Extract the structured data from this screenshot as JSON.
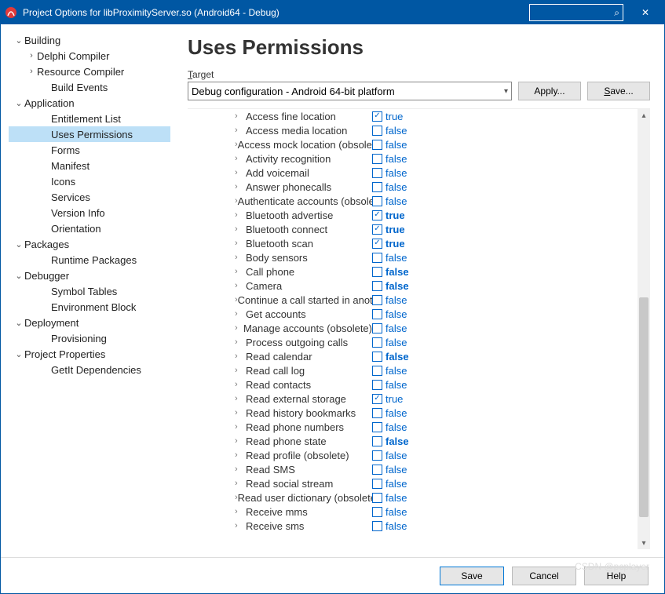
{
  "window": {
    "title": "Project Options for libProximityServer.so  (Android64 - Debug)",
    "search_placeholder": "",
    "close_glyph": "✕"
  },
  "sidebar": [
    {
      "label": "Building",
      "kind": "group",
      "open": true,
      "indent": 0
    },
    {
      "label": "Delphi Compiler",
      "kind": "sub",
      "indent": 1
    },
    {
      "label": "Resource Compiler",
      "kind": "sub",
      "indent": 1
    },
    {
      "label": "Build Events",
      "kind": "leaf",
      "indent": 2
    },
    {
      "label": "Application",
      "kind": "group",
      "open": true,
      "indent": 0
    },
    {
      "label": "Entitlement List",
      "kind": "leaf",
      "indent": 2
    },
    {
      "label": "Uses Permissions",
      "kind": "leaf",
      "indent": 2,
      "selected": true
    },
    {
      "label": "Forms",
      "kind": "leaf",
      "indent": 2
    },
    {
      "label": "Manifest",
      "kind": "leaf",
      "indent": 2
    },
    {
      "label": "Icons",
      "kind": "leaf",
      "indent": 2
    },
    {
      "label": "Services",
      "kind": "leaf",
      "indent": 2
    },
    {
      "label": "Version Info",
      "kind": "leaf",
      "indent": 2
    },
    {
      "label": "Orientation",
      "kind": "leaf",
      "indent": 2
    },
    {
      "label": "Packages",
      "kind": "group",
      "open": true,
      "indent": 0
    },
    {
      "label": "Runtime Packages",
      "kind": "leaf",
      "indent": 2
    },
    {
      "label": "Debugger",
      "kind": "group",
      "open": true,
      "indent": 0
    },
    {
      "label": "Symbol Tables",
      "kind": "leaf",
      "indent": 2
    },
    {
      "label": "Environment Block",
      "kind": "leaf",
      "indent": 2
    },
    {
      "label": "Deployment",
      "kind": "group",
      "open": true,
      "indent": 0
    },
    {
      "label": "Provisioning",
      "kind": "leaf",
      "indent": 2
    },
    {
      "label": "Project Properties",
      "kind": "group",
      "open": true,
      "indent": 0
    },
    {
      "label": "GetIt Dependencies",
      "kind": "leaf",
      "indent": 2
    }
  ],
  "main": {
    "heading": "Uses Permissions",
    "target_label": "Target",
    "target_value": "Debug configuration - Android 64-bit platform",
    "apply_label": "Apply...",
    "save_top_label": "Save..."
  },
  "permissions": [
    {
      "name": "Access fine location",
      "checked": true,
      "value": "true",
      "bold": false
    },
    {
      "name": "Access media location",
      "checked": false,
      "value": "false",
      "bold": false
    },
    {
      "name": "Access mock location (obsolete)",
      "checked": false,
      "value": "false",
      "bold": false
    },
    {
      "name": "Activity recognition",
      "checked": false,
      "value": "false",
      "bold": false
    },
    {
      "name": "Add voicemail",
      "checked": false,
      "value": "false",
      "bold": false
    },
    {
      "name": "Answer phonecalls",
      "checked": false,
      "value": "false",
      "bold": false
    },
    {
      "name": "Authenticate accounts (obsolete)",
      "checked": false,
      "value": "false",
      "bold": false
    },
    {
      "name": "Bluetooth advertise",
      "checked": true,
      "value": "true",
      "bold": true
    },
    {
      "name": "Bluetooth connect",
      "checked": true,
      "value": "true",
      "bold": true
    },
    {
      "name": "Bluetooth scan",
      "checked": true,
      "value": "true",
      "bold": true
    },
    {
      "name": "Body sensors",
      "checked": false,
      "value": "false",
      "bold": false
    },
    {
      "name": "Call phone",
      "checked": false,
      "value": "false",
      "bold": true
    },
    {
      "name": "Camera",
      "checked": false,
      "value": "false",
      "bold": true
    },
    {
      "name": "Continue a call started in another app",
      "checked": false,
      "value": "false",
      "bold": false
    },
    {
      "name": "Get accounts",
      "checked": false,
      "value": "false",
      "bold": false
    },
    {
      "name": "Manage accounts (obsolete)",
      "checked": false,
      "value": "false",
      "bold": false
    },
    {
      "name": "Process outgoing calls",
      "checked": false,
      "value": "false",
      "bold": false
    },
    {
      "name": "Read calendar",
      "checked": false,
      "value": "false",
      "bold": true
    },
    {
      "name": "Read call log",
      "checked": false,
      "value": "false",
      "bold": false
    },
    {
      "name": "Read contacts",
      "checked": false,
      "value": "false",
      "bold": false
    },
    {
      "name": "Read external storage",
      "checked": true,
      "value": "true",
      "bold": false
    },
    {
      "name": "Read history bookmarks",
      "checked": false,
      "value": "false",
      "bold": false
    },
    {
      "name": "Read phone numbers",
      "checked": false,
      "value": "false",
      "bold": false
    },
    {
      "name": "Read phone state",
      "checked": false,
      "value": "false",
      "bold": true
    },
    {
      "name": "Read profile (obsolete)",
      "checked": false,
      "value": "false",
      "bold": false
    },
    {
      "name": "Read SMS",
      "checked": false,
      "value": "false",
      "bold": false
    },
    {
      "name": "Read social stream",
      "checked": false,
      "value": "false",
      "bold": false
    },
    {
      "name": "Read user dictionary (obsolete)",
      "checked": false,
      "value": "false",
      "bold": false
    },
    {
      "name": "Receive mms",
      "checked": false,
      "value": "false",
      "bold": false
    },
    {
      "name": "Receive sms",
      "checked": false,
      "value": "false",
      "bold": false
    }
  ],
  "footer": {
    "save": "Save",
    "cancel": "Cancel",
    "help": "Help"
  },
  "watermark": "CSDN @pcplayer"
}
